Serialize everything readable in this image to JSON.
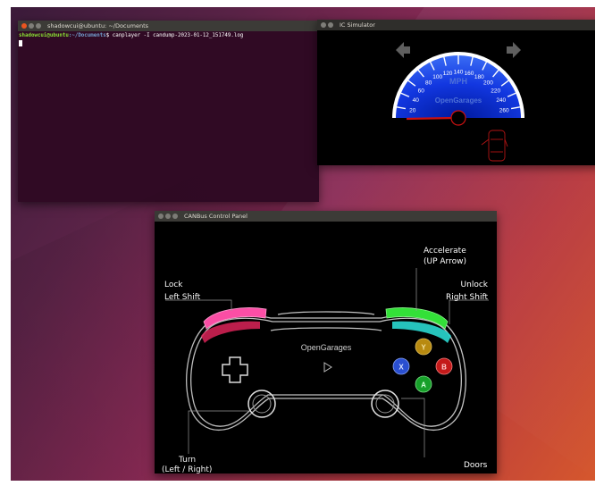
{
  "terminal": {
    "title": "shadowcui@ubuntu: ~/Documents",
    "prompt_user": "shadowcui@ubuntu",
    "prompt_path": ":~/Documents",
    "command": "$ canplayer -I candump-2023-01-12_151749.log"
  },
  "icsim": {
    "title": "IC Simulator",
    "speed_unit": "MPH",
    "brand": "OpenGarages",
    "speed_ticks": [
      "20",
      "40",
      "60",
      "80",
      "100",
      "120",
      "140",
      "160",
      "180",
      "200",
      "220",
      "240",
      "260"
    ],
    "current_speed": 0,
    "colors": {
      "gauge_blue": "#1a3bd6",
      "needle": "#cc1111",
      "arrow": "#5f5f5f"
    }
  },
  "canbus": {
    "title": "CANBus Control Panel",
    "controller_brand": "OpenGarages",
    "labels": {
      "lock": "Lock",
      "lock_key": "Left Shift",
      "accelerate": "Accelerate",
      "accelerate_key": "(UP Arrow)",
      "unlock": "Unlock",
      "unlock_key": "Right Shift",
      "turn": "Turn",
      "turn_key": "(Left / Right)",
      "doors": "Doors"
    },
    "buttons": {
      "y": "Y",
      "x": "X",
      "b": "B",
      "a": "A"
    },
    "colors": {
      "lock_bumper": "#ff4fa8",
      "accel_bumper": "#33e038",
      "unlock_bumper": "#2ad8d0",
      "y": "#b88a10",
      "x": "#2a4fd0",
      "b": "#c41a1a",
      "a": "#17a02a"
    }
  }
}
